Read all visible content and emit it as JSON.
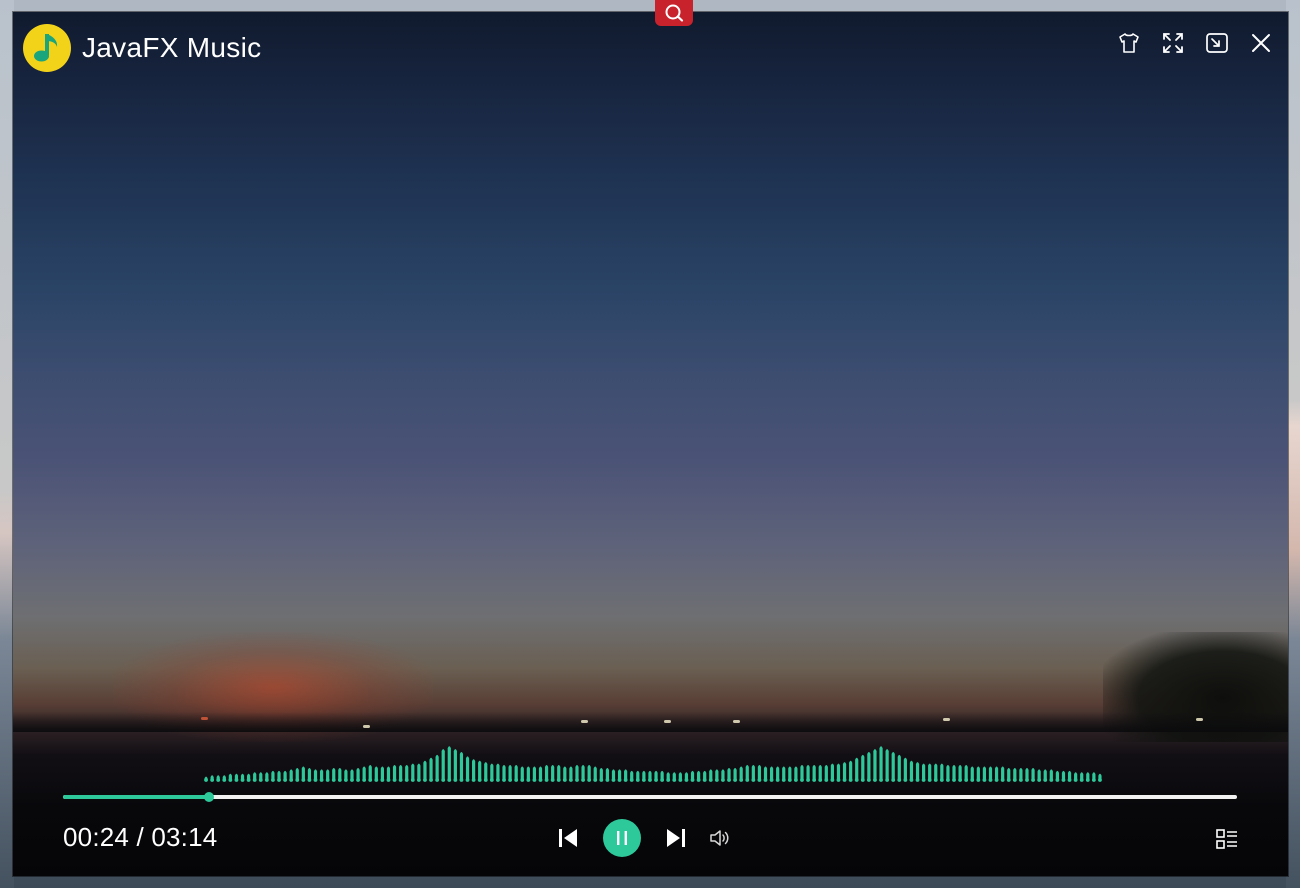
{
  "window": {
    "title": "JavaFX Music"
  },
  "titlebar_controls": [
    "skin-icon",
    "fullscreen-icon",
    "mini-mode-icon",
    "close-icon"
  ],
  "player": {
    "current_time": "00:24",
    "separator": " / ",
    "total_time": "03:14",
    "progress_fraction": 0.124
  },
  "spectrum": {
    "bar_heights": [
      3,
      4,
      4,
      4,
      5,
      5,
      5,
      5,
      6,
      6,
      6,
      7,
      7,
      7,
      8,
      9,
      10,
      9,
      8,
      8,
      8,
      9,
      9,
      8,
      8,
      9,
      10,
      11,
      10,
      10,
      10,
      11,
      11,
      11,
      12,
      12,
      14,
      16,
      18,
      22,
      24,
      22,
      20,
      17,
      15,
      14,
      13,
      12,
      12,
      11,
      11,
      11,
      10,
      10,
      10,
      10,
      11,
      11,
      11,
      10,
      10,
      11,
      11,
      11,
      10,
      9,
      9,
      8,
      8,
      8,
      7,
      7,
      7,
      7,
      7,
      7,
      6,
      6,
      6,
      6,
      7,
      7,
      7,
      8,
      8,
      8,
      9,
      9,
      10,
      11,
      11,
      11,
      10,
      10,
      10,
      10,
      10,
      10,
      11,
      11,
      11,
      11,
      11,
      12,
      12,
      13,
      14,
      16,
      18,
      20,
      22,
      24,
      22,
      20,
      18,
      16,
      14,
      13,
      12,
      12,
      12,
      12,
      11,
      11,
      11,
      11,
      10,
      10,
      10,
      10,
      10,
      10,
      9,
      9,
      9,
      9,
      9,
      8,
      8,
      8,
      7,
      7,
      7,
      6,
      6,
      6,
      6,
      5
    ],
    "color": "#2ec99b"
  },
  "colors": {
    "accent": "#2ec99b",
    "search_tab": "#c8232c",
    "logo": "#f3d21a"
  }
}
